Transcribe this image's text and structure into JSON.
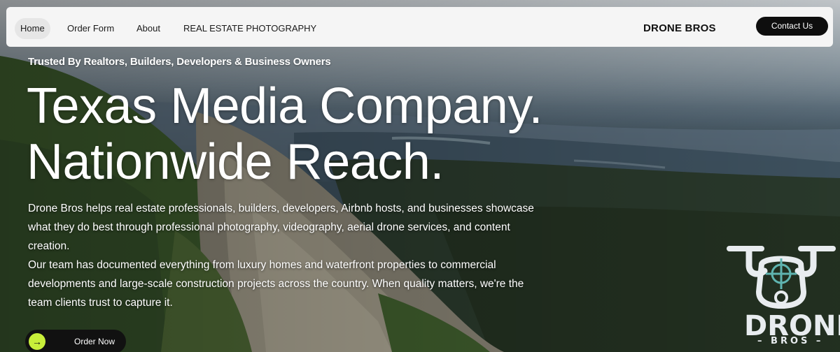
{
  "nav": {
    "items": [
      {
        "label": "Home",
        "active": true
      },
      {
        "label": "Order Form",
        "active": false
      },
      {
        "label": "About",
        "active": false
      },
      {
        "label": "REAL ESTATE PHOTOGRAPHY",
        "active": false
      }
    ],
    "brand": "DRONE BROS",
    "contact_label": "Contact Us"
  },
  "hero": {
    "tagline": "Trusted By Realtors, Builders, Developers & Business Owners",
    "headline_line1": "Texas Media Company.",
    "headline_line2": "Nationwide Reach.",
    "paragraph1": "Drone Bros helps real estate professionals, builders, developers, Airbnb hosts, and businesses showcase what they do best through professional photography, videography, aerial drone services, and content creation.",
    "paragraph2": "Our team has documented everything from luxury homes and waterfront properties to commercial developments and large-scale construction projects across the country. When quality matters, we're the team clients trust to capture it.",
    "order_label": "Order Now",
    "order_icon": "arrow-right-icon"
  },
  "logo": {
    "word": "DRONE",
    "sub": "BROS",
    "icon": "drone-icon"
  },
  "colors": {
    "nav_bg": "#f5f5f5",
    "button_dark": "#0e0e0e",
    "accent_lime": "#c8ef3a",
    "logo_teal": "#5fb4b0"
  }
}
